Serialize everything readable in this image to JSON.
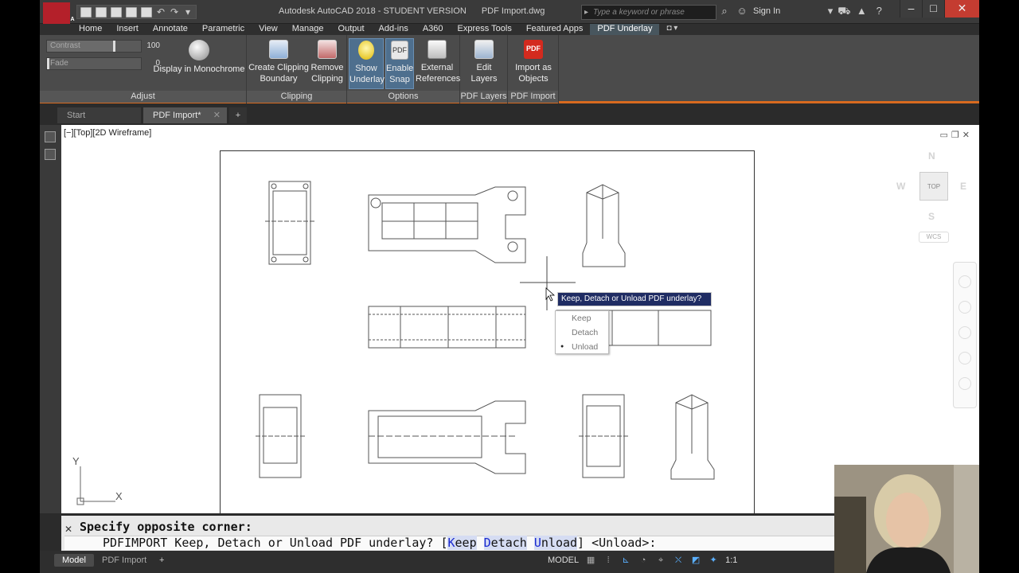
{
  "titlebar": {
    "app_title": "Autodesk AutoCAD 2018 - STUDENT VERSION",
    "file_name": "PDF Import.dwg",
    "search_placeholder": "Type a keyword or phrase",
    "sign_in": "Sign In",
    "logo_letter": "A"
  },
  "ribbon_tabs": [
    "Home",
    "Insert",
    "Annotate",
    "Parametric",
    "View",
    "Manage",
    "Output",
    "Add-ins",
    "A360",
    "Express Tools",
    "Featured Apps",
    "PDF Underlay"
  ],
  "ribbon": {
    "adjust": {
      "contrast_label": "Contrast",
      "contrast_value": "100",
      "fade_label": "Fade",
      "fade_value": "0",
      "monochrome_label": "Display in Monochrome",
      "panel_title": "Adjust"
    },
    "clipping": {
      "create_label": "Create Clipping Boundary",
      "remove_label": "Remove Clipping",
      "panel_title": "Clipping"
    },
    "options": {
      "show_label": "Show Underlay",
      "snap_label": "Enable Snap",
      "external_label": "External References",
      "panel_title": "Options"
    },
    "layers": {
      "edit_label": "Edit Layers",
      "panel_title": "PDF Layers"
    },
    "import": {
      "import_label": "Import as Objects",
      "panel_title": "PDF Import",
      "pdf_badge": "PDF"
    }
  },
  "doc_tabs": [
    {
      "label": "Start"
    },
    {
      "label": "PDF Import*"
    }
  ],
  "viewport": {
    "label": "[−][Top][2D Wireframe]",
    "viewcube": {
      "n": "N",
      "s": "S",
      "e": "E",
      "w": "W",
      "top": "TOP",
      "wcs": "WCS"
    }
  },
  "dynamic_prompt": {
    "tooltip": "Keep, Detach or Unload PDF underlay?",
    "options": [
      "Keep",
      "Detach",
      "Unload"
    ],
    "selected": "Unload"
  },
  "ucs": {
    "x": "X",
    "y": "Y"
  },
  "command": {
    "history": "Specify opposite corner:",
    "prompt_prefix": "PDFIMPORT Keep, Detach or Unload PDF underlay? [",
    "opt_keep_key": "K",
    "opt_keep_rest": "eep",
    "opt_detach_key": "D",
    "opt_detach_rest": "etach",
    "opt_unload_key": "U",
    "opt_unload_rest": "nload",
    "prompt_suffix": "] <Unload>:"
  },
  "status": {
    "model_tab": "Model",
    "layout_tab": "PDF Import",
    "model_label": "MODEL",
    "scale": "1:1"
  },
  "colors": {
    "accent_orange": "#d86a1f",
    "tooltip_bg": "#1f2c63",
    "active_option": "#4e6f8e"
  }
}
